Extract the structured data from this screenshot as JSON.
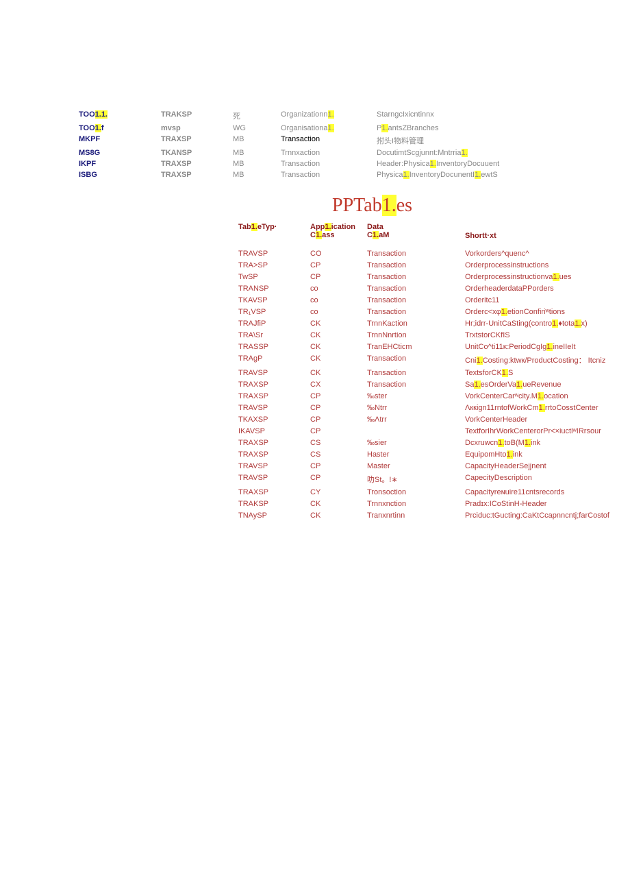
{
  "topRows": [
    {
      "c0a": "TOO",
      "c0hl": "1.1.",
      "c0b": "",
      "c1": "TRAKSP",
      "c2": "死",
      "c3a": "Organizationn",
      "c3hl": "1.",
      "c3b": "",
      "c4": "StarngcIxicntinnx"
    },
    {
      "c0a": "TOO",
      "c0hl": "1.",
      "c0b": "f",
      "c1": "mvsp",
      "c2": "WG",
      "c3a": "Organisationa",
      "c3hl": "1.",
      "c3b": "",
      "c4a": "P",
      "c4hl": "1.",
      "c4b": "antsZBranches"
    },
    {
      "c0": "MKPF",
      "c1": "TRAXSP",
      "c2": "MB",
      "c3": "Transaction",
      "c3black": true,
      "c4": "拊头I物料管理"
    },
    {
      "c0": "MS8G",
      "c1": "TKANSP",
      "c2": "MB",
      "c3": "Trnnxaction",
      "c4a": "DocutimtScgjunnt:Mntrria",
      "c4hl": "1."
    },
    {
      "c0": "IKPF",
      "c1": "TRAXSP",
      "c2": "MB",
      "c3": "Transaction",
      "c4a": "Header:Physica",
      "c4hl": "1.",
      "c4b": "InventoryDocuuent"
    },
    {
      "c0": "ISBG",
      "c1": "TRAXSP",
      "c2": "MB",
      "c3": "Transaction",
      "c4a": "Physica",
      "c4hl": "1.",
      "c4b": "InventoryDocunentI",
      "c4hl2": "1.",
      "c4c": "ewtS"
    }
  ],
  "sectionTitle": {
    "a": "PPTab",
    "hl": "1.",
    "b": "es"
  },
  "ppHeader": {
    "col0a": "Tab",
    "col0hl": "1.",
    "col0b": "eTyp·",
    "col1a": "App",
    "col1hl": "1.",
    "col1b": "ication",
    "col1_2a": "C",
    "col1_2hl": "1.",
    "col1_2b": "ass",
    "col2": "Data",
    "col2_2a": "C",
    "col2_2hl": "1.",
    "col2_2b": "aM",
    "col3": "Shortt·xt"
  },
  "ppRows": [
    {
      "c0": "TRAVSP",
      "c1": "CO",
      "c2": "Transaction",
      "c3": "Vorkorders^quenc^"
    },
    {
      "c0": "TRA>SP",
      "c1": "CP",
      "c2": "Transaction",
      "c3": "Orderprocessinstructions"
    },
    {
      "c0": "TwSP",
      "c1": "CP",
      "c2": "Transaction",
      "c3a": "Orderprocessinstructionva",
      "c3hl": "1.",
      "c3b": "ues"
    },
    {
      "c0": "TRANSP",
      "c1": "co",
      "c2": "Transaction",
      "c3": "OrderheaderdataPPorders"
    },
    {
      "c0": "TKAVSP",
      "c1": "co",
      "c2": "Transaction",
      "c3": "Orderitc11"
    },
    {
      "c0": "TR₁VSP",
      "c1": "co",
      "c2": "Transaction",
      "c3a": "Orderc<xφ",
      "c3hl": "1.",
      "c3b": "etionConfiriʷtions"
    },
    {
      "c0": "TRAJfiP",
      "c1": "CK",
      "c2": "TrnnKaction",
      "c3a": "Hr;idrr-UnitCaSting(contro",
      "c3hl": "1.",
      "c3b": "♦tota",
      "c3hl2": "1.",
      "c3c": "x)"
    },
    {
      "c0": "TRA\\Sr",
      "c1": "CK",
      "c2": "TrnnNnrtion",
      "c3": "TrxtstorCKfIS"
    },
    {
      "c0": "TRASSP",
      "c1": "CK",
      "c2": "TranEHCticm",
      "c3a": "UnitCo^ti11κ:PeriodCgIg",
      "c3hl": "1.",
      "c3b": "ineIIeIt"
    },
    {
      "c0": "TRAgP",
      "c1": "CK",
      "c2": "Transaction",
      "c3a": "Cni",
      "c3hl": "1.",
      "c3b": "Costing:ktwк/ProductCosting： Itcniz"
    },
    {
      "c0": "TRAVSP",
      "c1": "CK",
      "c2": "Transaction",
      "c3a": "TextsforCK",
      "c3hl": "1.",
      "c3b": "S"
    },
    {
      "c0": "TRAXSP",
      "c1": "CX",
      "c2": "Transaction",
      "c3a": "Sa",
      "c3hl": "1.",
      "c3b": "esOrderVa",
      "c3hl2": "1.",
      "c3c": "ueRevenue"
    },
    {
      "c0": "TRAXSP",
      "c1": "CP",
      "c2": "‰ster",
      "c3a": "VorkCenterCarʷcity.M",
      "c3hl": "1.",
      "c3b": "ocation"
    },
    {
      "c0": "TRAVSP",
      "c1": "CP",
      "c2": "‰Ntrr",
      "c3a": "Λккign11rntofWorkCm",
      "c3hl": "1.",
      "c3b": "rrtoCosstCenter"
    },
    {
      "c0": "TKAXSP",
      "c1": "CP",
      "c2": "‰Λtrr",
      "c3": "VorkCenterHeader"
    },
    {
      "c0": "IKAVSP",
      "c1": "CP",
      "c2": "",
      "c3": "TextforIhrWorkCenterorPr<×iuctiʷIRrsour"
    },
    {
      "c0": "TRAXSP",
      "c1": "CS",
      "c2": "‰sier",
      "c3a": "Dcxruwcn",
      "c3hl": "1.",
      "c3b": "toB(M",
      "c3hl2": "1.",
      "c3c": "ink"
    },
    {
      "c0": "TRAXSP",
      "c1": "CS",
      "c2": "Haster",
      "c3a": "EquipomHto",
      "c3hl": "1.",
      "c3b": "ink"
    },
    {
      "c0": "TRAVSP",
      "c1": "CP",
      "c2": "Master",
      "c3": "CapacityHeaderSejjnent"
    },
    {
      "c0": "TRAVSP",
      "c1": "CP",
      "c2": "叻St。!∗",
      "c3": "CapecityDescription"
    },
    {
      "c0": "TRAXSP",
      "c1": "CY",
      "c2": "Tronsoction",
      "c3": "Capacityreɴuire11cntsrecords"
    },
    {
      "c0": "TRAKSP",
      "c1": "CK",
      "c2": "Trnnxnction",
      "c3": "Pradɪx:ICoStinH-Header"
    },
    {
      "c0": "TNAySP",
      "c1": "CK",
      "c2": "Tranxnrtinn",
      "c3": "Prciduc:tGucting:CaKtCcapnncntj;farCostof"
    }
  ]
}
